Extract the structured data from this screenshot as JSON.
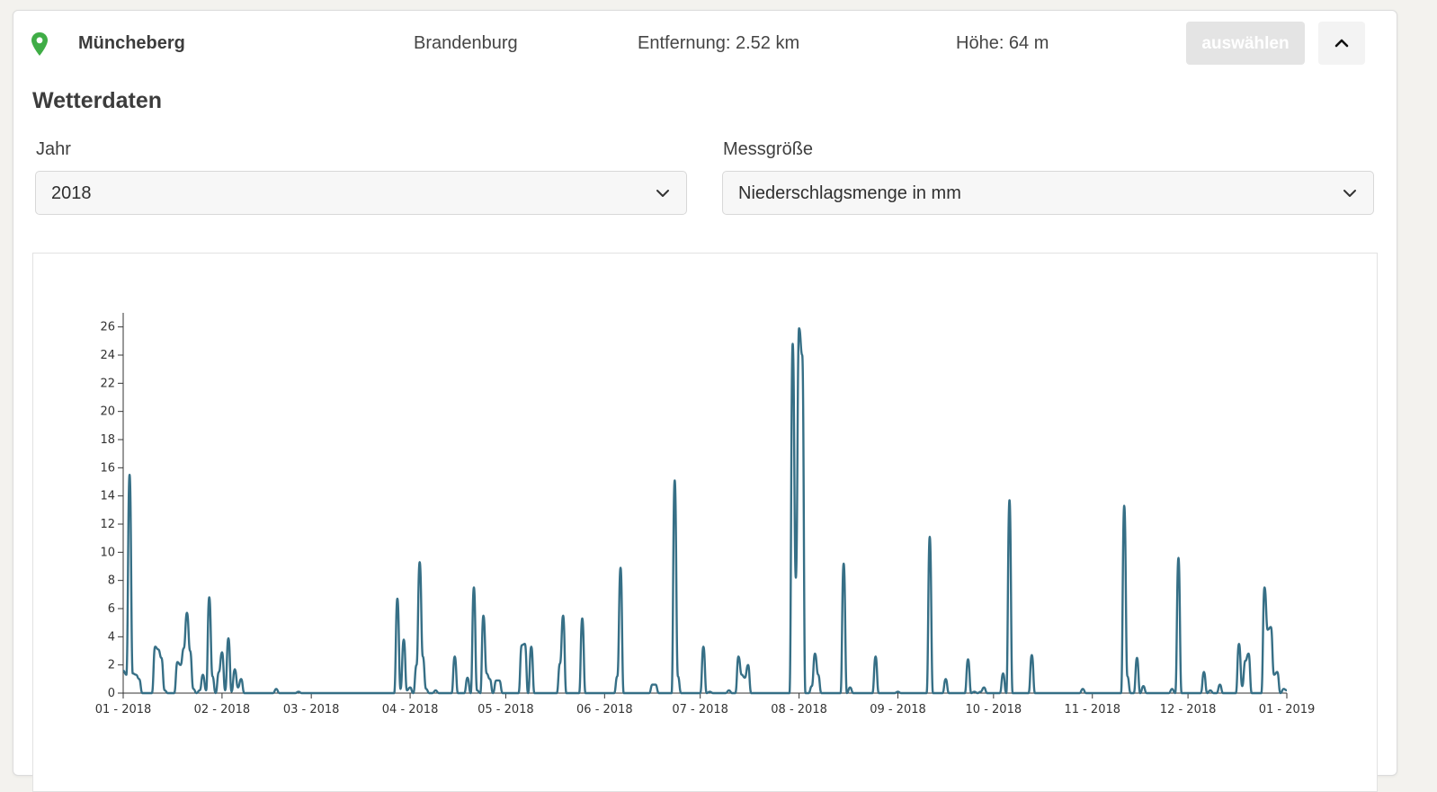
{
  "station": {
    "name": "Müncheberg",
    "state": "Brandenburg",
    "distance": "Entfernung: 2.52 km",
    "height": "Höhe: 64 m",
    "select_label": "auswählen",
    "pin_icon": "map-pin-icon",
    "collapse_icon": "chevron-up-icon",
    "accent_color": "#3fad46"
  },
  "section": {
    "title": "Wetterdaten"
  },
  "filters": {
    "year_label": "Jahr",
    "year_value": "2018",
    "measure_label": "Messgröße",
    "measure_value": "Niederschlagsmenge in mm"
  },
  "chart_data": {
    "type": "line",
    "title": "",
    "xlabel": "",
    "ylabel": "",
    "ylim": [
      0,
      27
    ],
    "yticks": [
      0,
      2,
      4,
      6,
      8,
      10,
      12,
      14,
      16,
      18,
      20,
      22,
      24,
      26
    ],
    "xtick_labels": [
      "01 - 2018",
      "02 - 2018",
      "03 - 2018",
      "04 - 2018",
      "05 - 2018",
      "06 - 2018",
      "07 - 2018",
      "08 - 2018",
      "09 - 2018",
      "10 - 2018",
      "11 - 2018",
      "12 - 2018",
      "01 - 2019"
    ],
    "x_unit": "day of year 2018",
    "xlim": [
      1,
      366
    ],
    "grid": false,
    "line_color": "#366f86",
    "series": [
      {
        "values": [
          [
            1,
            1.6
          ],
          [
            2,
            1.3
          ],
          [
            3,
            15.5
          ],
          [
            4,
            1.4
          ],
          [
            5,
            1.3
          ],
          [
            6,
            1.0
          ],
          [
            7,
            0
          ],
          [
            8,
            0
          ],
          [
            9,
            0
          ],
          [
            10,
            0
          ],
          [
            11,
            3.3
          ],
          [
            12,
            3.1
          ],
          [
            13,
            2.5
          ],
          [
            14,
            0.2
          ],
          [
            15,
            0
          ],
          [
            16,
            0
          ],
          [
            17,
            0
          ],
          [
            18,
            2.2
          ],
          [
            19,
            2.0
          ],
          [
            20,
            3.2
          ],
          [
            21,
            5.7
          ],
          [
            22,
            3.0
          ],
          [
            23,
            0.3
          ],
          [
            24,
            0
          ],
          [
            25,
            0.2
          ],
          [
            26,
            1.3
          ],
          [
            27,
            0.2
          ],
          [
            28,
            6.8
          ],
          [
            29,
            1.2
          ],
          [
            30,
            0
          ],
          [
            31,
            1.5
          ],
          [
            32,
            2.9
          ],
          [
            33,
            0.2
          ],
          [
            34,
            3.9
          ],
          [
            35,
            0.1
          ],
          [
            36,
            1.7
          ],
          [
            37,
            0.4
          ],
          [
            38,
            1.0
          ],
          [
            39,
            0
          ],
          [
            40,
            0
          ],
          [
            48,
            0
          ],
          [
            49,
            0.3
          ],
          [
            50,
            0
          ],
          [
            55,
            0
          ],
          [
            56,
            0.1
          ],
          [
            57,
            0
          ],
          [
            60,
            0
          ],
          [
            70,
            0
          ],
          [
            80,
            0
          ],
          [
            85,
            0
          ],
          [
            86,
            0
          ],
          [
            87,
            6.7
          ],
          [
            88,
            0.3
          ],
          [
            89,
            3.8
          ],
          [
            90,
            0.2
          ],
          [
            91,
            0.4
          ],
          [
            92,
            0
          ],
          [
            93,
            2.0
          ],
          [
            94,
            9.3
          ],
          [
            95,
            2.6
          ],
          [
            96,
            0.3
          ],
          [
            97,
            0
          ],
          [
            98,
            0
          ],
          [
            99,
            0.2
          ],
          [
            100,
            0
          ],
          [
            103,
            0
          ],
          [
            104,
            0
          ],
          [
            105,
            2.6
          ],
          [
            106,
            0
          ],
          [
            108,
            0
          ],
          [
            109,
            1.1
          ],
          [
            110,
            0
          ],
          [
            111,
            7.5
          ],
          [
            112,
            0.2
          ],
          [
            113,
            0
          ],
          [
            114,
            5.5
          ],
          [
            115,
            1.4
          ],
          [
            116,
            1.0
          ],
          [
            117,
            0
          ],
          [
            118,
            0.9
          ],
          [
            119,
            0.9
          ],
          [
            120,
            0
          ],
          [
            124,
            0
          ],
          [
            125,
            0
          ],
          [
            126,
            3.4
          ],
          [
            127,
            3.5
          ],
          [
            128,
            0
          ],
          [
            129,
            3.3
          ],
          [
            130,
            0
          ],
          [
            137,
            0
          ],
          [
            138,
            2.1
          ],
          [
            139,
            5.5
          ],
          [
            140,
            0
          ],
          [
            144,
            0
          ],
          [
            145,
            5.3
          ],
          [
            146,
            0
          ],
          [
            155,
            0
          ],
          [
            156,
            1.2
          ],
          [
            157,
            8.9
          ],
          [
            158,
            0
          ],
          [
            166,
            0
          ],
          [
            167,
            0.6
          ],
          [
            168,
            0.6
          ],
          [
            169,
            0
          ],
          [
            173,
            0
          ],
          [
            174,
            15.1
          ],
          [
            175,
            1.2
          ],
          [
            176,
            0
          ],
          [
            182,
            0
          ],
          [
            183,
            3.3
          ],
          [
            184,
            0
          ],
          [
            185,
            0.1
          ],
          [
            186,
            0
          ],
          [
            190,
            0
          ],
          [
            191,
            0.2
          ],
          [
            192,
            0
          ],
          [
            193,
            0
          ],
          [
            194,
            2.6
          ],
          [
            195,
            1.3
          ],
          [
            196,
            1.1
          ],
          [
            197,
            2.0
          ],
          [
            198,
            0
          ],
          [
            205,
            0
          ],
          [
            210,
            0
          ],
          [
            211,
            24.8
          ],
          [
            212,
            8.2
          ],
          [
            213,
            25.9
          ],
          [
            214,
            24.0
          ],
          [
            215,
            0
          ],
          [
            216,
            0
          ],
          [
            217,
            0.5
          ],
          [
            218,
            2.8
          ],
          [
            219,
            1.3
          ],
          [
            220,
            0
          ],
          [
            226,
            0
          ],
          [
            227,
            9.2
          ],
          [
            228,
            0
          ],
          [
            229,
            0.4
          ],
          [
            230,
            0
          ],
          [
            236,
            0
          ],
          [
            237,
            2.6
          ],
          [
            238,
            0
          ],
          [
            243,
            0
          ],
          [
            244,
            0.1
          ],
          [
            245,
            0
          ],
          [
            253,
            0
          ],
          [
            254,
            11.1
          ],
          [
            255,
            0
          ],
          [
            258,
            0
          ],
          [
            259,
            1.0
          ],
          [
            260,
            0
          ],
          [
            262,
            0
          ],
          [
            265,
            0
          ],
          [
            266,
            2.4
          ],
          [
            267,
            0
          ],
          [
            268,
            0.1
          ],
          [
            269,
            0
          ],
          [
            270,
            0.1
          ],
          [
            271,
            0.4
          ],
          [
            272,
            0
          ],
          [
            276,
            0
          ],
          [
            277,
            1.4
          ],
          [
            278,
            0
          ],
          [
            279,
            13.7
          ],
          [
            280,
            0
          ],
          [
            284,
            0
          ],
          [
            285,
            0
          ],
          [
            286,
            2.7
          ],
          [
            287,
            0
          ],
          [
            300,
            0
          ],
          [
            301,
            0
          ],
          [
            302,
            0.3
          ],
          [
            303,
            0
          ],
          [
            304,
            0
          ],
          [
            305,
            0
          ],
          [
            310,
            0
          ],
          [
            314,
            0
          ],
          [
            315,
            13.3
          ],
          [
            316,
            1.2
          ],
          [
            317,
            0
          ],
          [
            318,
            0
          ],
          [
            319,
            2.5
          ],
          [
            320,
            0
          ],
          [
            321,
            0.5
          ],
          [
            322,
            0
          ],
          [
            328,
            0
          ],
          [
            329,
            0
          ],
          [
            330,
            0.3
          ],
          [
            331,
            0
          ],
          [
            332,
            9.6
          ],
          [
            333,
            0
          ],
          [
            339,
            0
          ],
          [
            340,
            1.5
          ],
          [
            341,
            0
          ],
          [
            342,
            0.2
          ],
          [
            343,
            0
          ],
          [
            344,
            0
          ],
          [
            345,
            0.6
          ],
          [
            346,
            0
          ],
          [
            350,
            0
          ],
          [
            351,
            3.5
          ],
          [
            352,
            0.5
          ],
          [
            353,
            2.3
          ],
          [
            354,
            2.8
          ],
          [
            355,
            0
          ],
          [
            356,
            0
          ],
          [
            357,
            0
          ],
          [
            358,
            0
          ],
          [
            359,
            7.5
          ],
          [
            360,
            4.5
          ],
          [
            361,
            4.7
          ],
          [
            362,
            1.3
          ],
          [
            363,
            1.5
          ],
          [
            364,
            0
          ],
          [
            365,
            0.3
          ],
          [
            366,
            0.2
          ]
        ]
      }
    ]
  }
}
